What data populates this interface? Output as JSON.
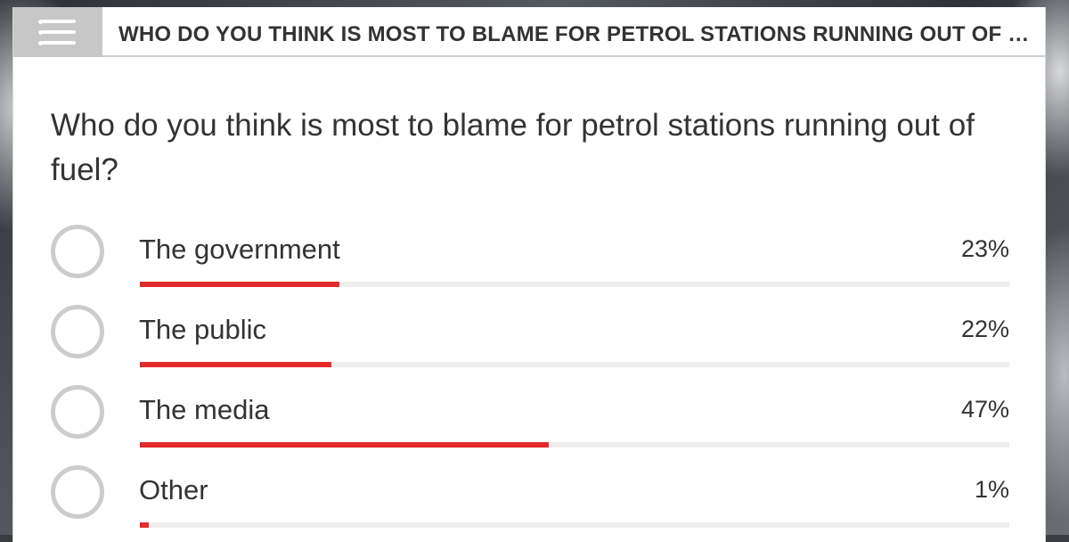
{
  "header": {
    "title": "WHO DO YOU THINK IS MOST TO BLAME FOR PETROL STATIONS RUNNING OUT OF FUEL?",
    "menu_icon": "list-menu-icon"
  },
  "poll": {
    "question": "Who do you think is most to blame for petrol stations running out of fuel?",
    "options": [
      {
        "label": "The government",
        "percent_text": "23%",
        "percent": 23
      },
      {
        "label": "The public",
        "percent_text": "22%",
        "percent": 22
      },
      {
        "label": "The media",
        "percent_text": "47%",
        "percent": 47
      },
      {
        "label": "Other",
        "percent_text": "1%",
        "percent": 1
      }
    ]
  },
  "colors": {
    "bar_fill": "#e52a2a",
    "bar_track": "#eeeeee",
    "radio_border": "#cccccc",
    "menu_box": "#c7c7c7",
    "text": "#333333"
  }
}
